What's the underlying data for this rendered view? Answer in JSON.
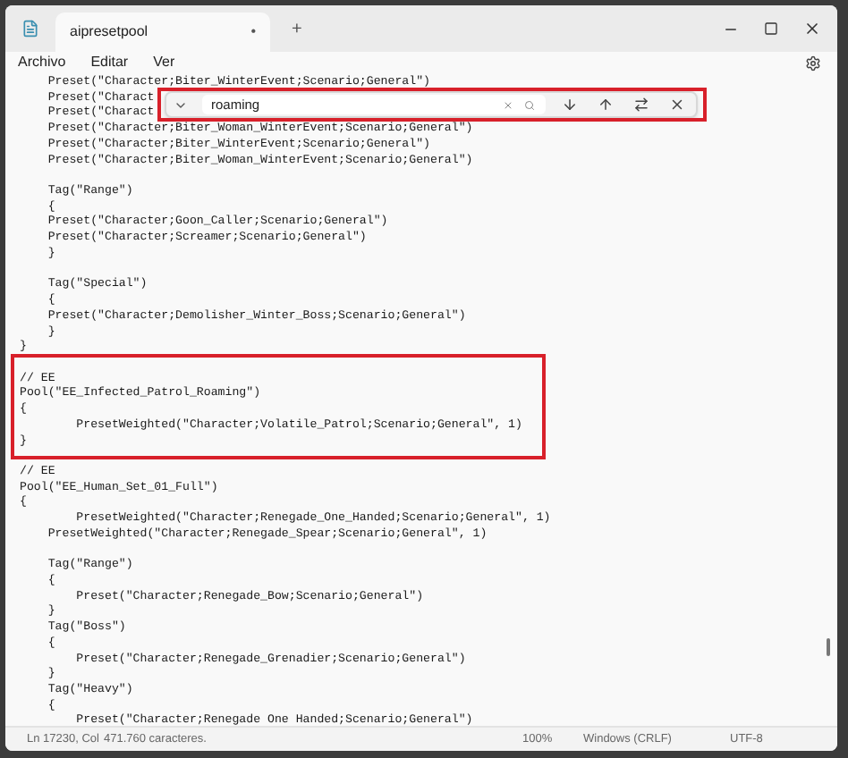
{
  "window": {
    "tab_title": "aipresetpool",
    "tab_close": "•",
    "new_tab": "+"
  },
  "menu": [
    "Archivo",
    "Editar",
    "Ver"
  ],
  "find_bar": {
    "value": "roaming"
  },
  "lines": [
    {
      "text": "    Preset(\"Character;Biter_WinterEvent;Scenario;General\")"
    },
    {
      "text": "    Preset(\"Charact"
    },
    {
      "text": "    Preset(\"Charact"
    },
    {
      "text": "    Preset(\"Character;Biter_Woman_WinterEvent;Scenario;General\")"
    },
    {
      "text": "    Preset(\"Character;Biter_WinterEvent;Scenario;General\")"
    },
    {
      "text": "    Preset(\"Character;Biter_Woman_WinterEvent;Scenario;General\")"
    },
    {
      "kind": "blank"
    },
    {
      "text": "    Tag(\"Range\")"
    },
    {
      "text": "    {"
    },
    {
      "text": "    Preset(\"Character;Goon_Caller;Scenario;General\")"
    },
    {
      "text": "    Preset(\"Character;Screamer;Scenario;General\")"
    },
    {
      "text": "    }"
    },
    {
      "kind": "blank"
    },
    {
      "text": "    Tag(\"Special\")"
    },
    {
      "text": "    {"
    },
    {
      "text": "    Preset(\"Character;Demolisher_Winter_Boss;Scenario;General\")"
    },
    {
      "text": "    }"
    },
    {
      "text": "}"
    },
    {
      "kind": "blank"
    },
    {
      "text": "// EE"
    },
    {
      "text": "Pool(\"EE_Infected_Patrol_Roaming\")"
    },
    {
      "text": "{"
    },
    {
      "text": "        PresetWeighted(\"Character;Volatile_Patrol;Scenario;General\", 1)"
    },
    {
      "text": "}"
    },
    {
      "kind": "blank"
    },
    {
      "text": "// EE"
    },
    {
      "text": "Pool(\"EE_Human_Set_01_Full\")"
    },
    {
      "text": "{"
    },
    {
      "text": "        PresetWeighted(\"Character;Renegade_One_Handed;Scenario;General\", 1)"
    },
    {
      "text": "    PresetWeighted(\"Character;Renegade_Spear;Scenario;General\", 1)"
    },
    {
      "kind": "blank"
    },
    {
      "text": "    Tag(\"Range\")"
    },
    {
      "text": "    {"
    },
    {
      "text": "        Preset(\"Character;Renegade_Bow;Scenario;General\")"
    },
    {
      "text": "    }"
    },
    {
      "text": "    Tag(\"Boss\")"
    },
    {
      "text": "    {"
    },
    {
      "text": "        Preset(\"Character;Renegade_Grenadier;Scenario;General\")"
    },
    {
      "text": "    }"
    },
    {
      "text": "    Tag(\"Heavy\")"
    },
    {
      "text": "    {"
    },
    {
      "text": "        Preset(\"Character;Renegade One Handed;Scenario;General\")"
    }
  ],
  "status_bar": {
    "position": "Ln 17230, Col",
    "characters": "471.760 caracteres.",
    "zoom": "100%",
    "line_endings": "Windows (CRLF)",
    "encoding": "UTF-8"
  }
}
